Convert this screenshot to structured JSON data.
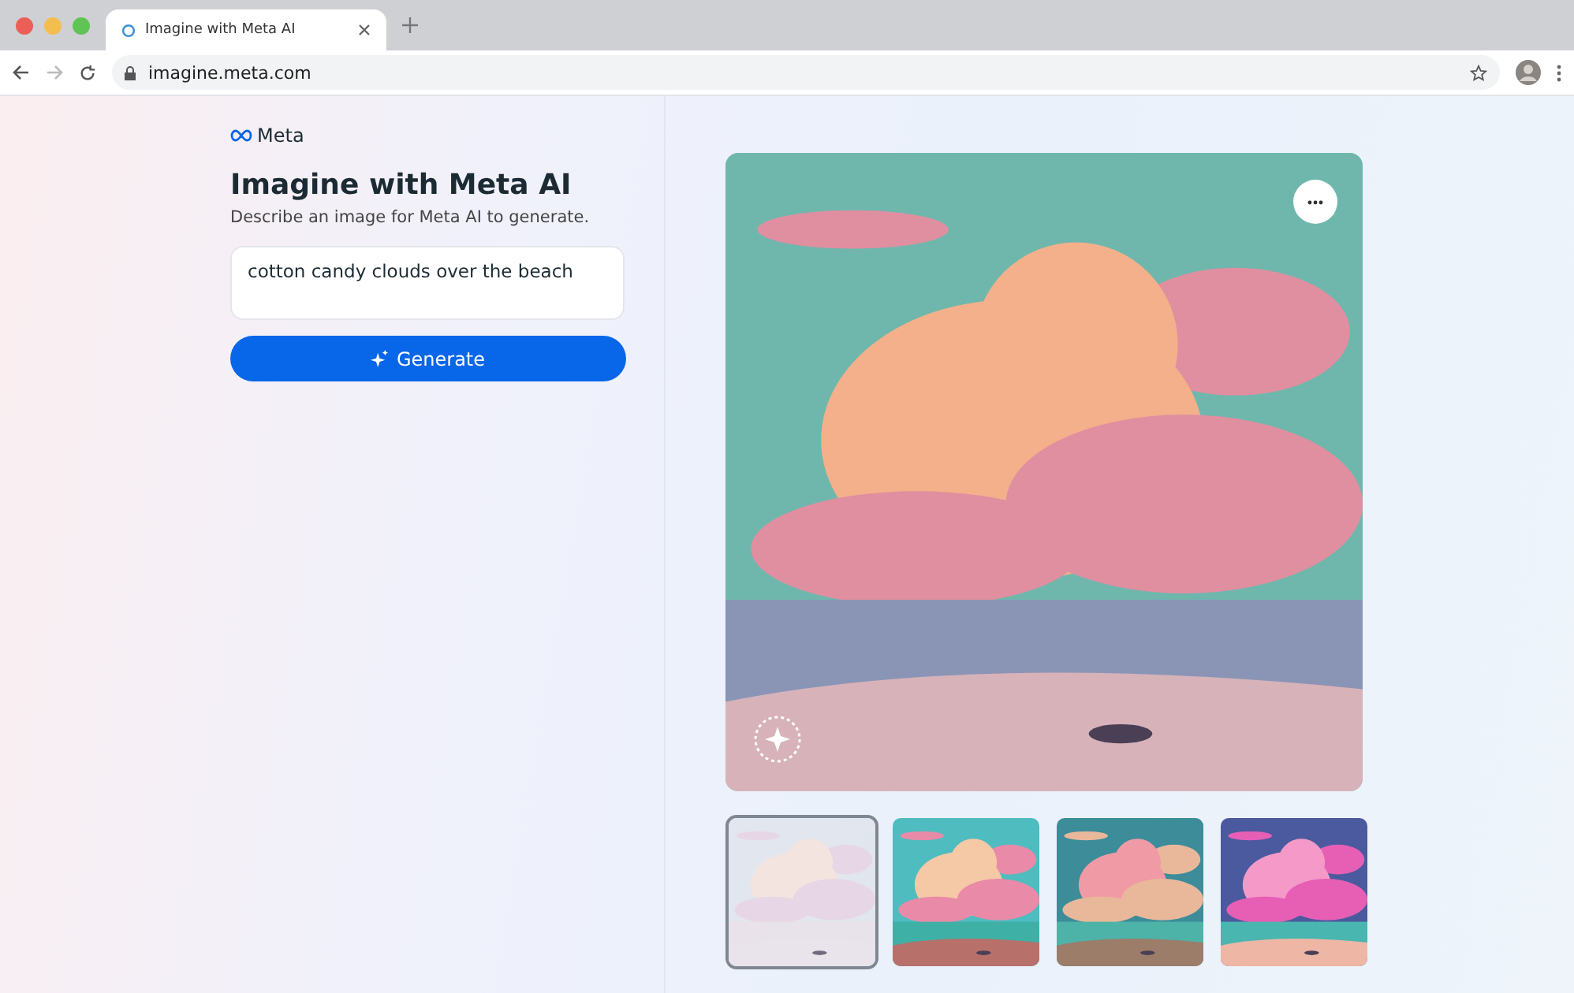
{
  "browser": {
    "tab": {
      "title": "Imagine with Meta AI"
    },
    "url": "imagine.meta.com"
  },
  "sidebar": {
    "logo": "Meta",
    "heading": "Imagine with Meta AI",
    "subtitle": "Describe an image for Meta AI to generate.",
    "prompt": {
      "value": "cotton candy clouds over the beach"
    },
    "button": "Generate"
  },
  "preview": {
    "main": {
      "kind": "picture"
    },
    "thumbnails": [
      {
        "kind": "picture",
        "selected": true
      },
      {
        "kind": "picture",
        "selected": false
      },
      {
        "kind": "picture",
        "selected": false
      },
      {
        "kind": "picture",
        "selected": false
      }
    ]
  }
}
